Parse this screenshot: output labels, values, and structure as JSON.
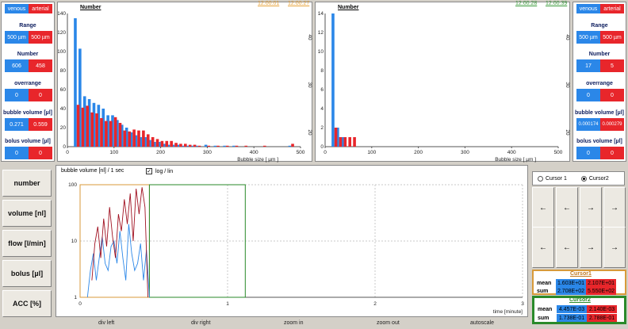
{
  "left_panel": {
    "tabs": {
      "venous": "venous",
      "arterial": "arterial"
    },
    "range": {
      "label": "Range",
      "venous": "500 µm",
      "arterial": "500 µm"
    },
    "number": {
      "label": "Number",
      "venous": "606",
      "arterial": "458"
    },
    "overrange": {
      "label": "overrange",
      "venous": "0",
      "arterial": "0"
    },
    "bubble_volume": {
      "label": "bubble volume [µl]",
      "venous": "0.271",
      "arterial": "0.559"
    },
    "bolus_volume": {
      "label": "bolus volume [µl]",
      "venous": "0",
      "arterial": "0"
    }
  },
  "right_panel": {
    "tabs": {
      "venous": "venous",
      "arterial": "arterial"
    },
    "range": {
      "label": "Range",
      "venous": "500 µm",
      "arterial": "500 µm"
    },
    "number": {
      "label": "Number",
      "venous": "17",
      "arterial": "5"
    },
    "overrange": {
      "label": "overrange",
      "venous": "0",
      "arterial": "0"
    },
    "bubble_volume": {
      "label": "bubble volume [µl]",
      "venous": "0.000174",
      "arterial": "0.000279"
    },
    "bolus_volume": {
      "label": "bolus volume [µl]",
      "venous": "0",
      "arterial": "0"
    }
  },
  "hist1": {
    "title": "Number",
    "time_a": "12:00:01",
    "time_b": "12:00:27",
    "color_a": "#e8a33a",
    "color_b": "#e8a33a",
    "xlabel": "Bubble size [ µm ]",
    "y_right_ticks": [
      "40",
      "30",
      "20"
    ]
  },
  "hist2": {
    "title": "Number",
    "time_a": "12:00:28",
    "time_b": "12:00:39",
    "color_a": "#3a9a3a",
    "color_b": "#3a9a3a",
    "xlabel": "Bubble size [ µm ]",
    "y_right_ticks": [
      "40",
      "30",
      "20"
    ]
  },
  "left_buttons": [
    "number",
    "volume [nl]",
    "flow [l/min]",
    "bolus [µl]",
    "ACC [%]"
  ],
  "trend": {
    "ylabel": "bubble volume [nl] / 1 sec",
    "log_label": "log / lin",
    "log_checked": true,
    "xlabel": "time [minute]",
    "yticks": [
      "100",
      "10",
      "1"
    ],
    "xticks": [
      "0",
      "1",
      "2",
      "3"
    ]
  },
  "bottom_actions": [
    "div left",
    "div right",
    "zoom in",
    "zoom out",
    "autoscale"
  ],
  "cursor_select": {
    "cursor1": "Cursor 1",
    "cursor2": "Cursor2",
    "selected": "Cursor2"
  },
  "arrows": {
    "big_left": "←",
    "small_left": "←",
    "small_right": "→",
    "big_right": "→"
  },
  "cursor1": {
    "title": "Cursor1",
    "mean_label": "mean",
    "sum_label": "sum",
    "mean_v": "1.603E+01",
    "mean_a": "2.107E+01",
    "sum_v": "2.708E+02",
    "sum_a": "5.550E+02",
    "color": "#d89a3a"
  },
  "cursor2": {
    "title": "Cursor2",
    "mean_label": "mean",
    "sum_label": "sum",
    "mean_v": "4.457E-03",
    "mean_a": "2.140E-03",
    "sum_v": "1.738E-01",
    "sum_a": "2.788E-01",
    "color": "#2a8a2a"
  },
  "chart_data": [
    {
      "type": "bar",
      "title": "Number",
      "xlabel": "Bubble size [ µm ]",
      "xlim": [
        0,
        500
      ],
      "ylim": [
        0,
        140
      ],
      "xticks": [
        0,
        100,
        200,
        300,
        400,
        500
      ],
      "yticks": [
        0,
        20,
        40,
        60,
        80,
        100,
        120,
        140
      ],
      "x": [
        20,
        30,
        40,
        50,
        60,
        70,
        80,
        90,
        100,
        110,
        120,
        130,
        140,
        150,
        160,
        170,
        180,
        190,
        200,
        210,
        220,
        230,
        240,
        250,
        260,
        270,
        280,
        300,
        320,
        340,
        360,
        380,
        420,
        480
      ],
      "series": [
        {
          "name": "venous",
          "color": "#2b87e8",
          "values": [
            135,
            103,
            53,
            50,
            46,
            44,
            40,
            33,
            33,
            28,
            23,
            20,
            15,
            12,
            10,
            10,
            7,
            5,
            5,
            3,
            2,
            2,
            2,
            1,
            1,
            1,
            1,
            2,
            1,
            1,
            1,
            0,
            0,
            1
          ]
        },
        {
          "name": "arterial",
          "color": "#e8262b",
          "values": [
            44,
            41,
            43,
            36,
            35,
            30,
            27,
            27,
            31,
            25,
            17,
            16,
            18,
            17,
            17,
            13,
            10,
            8,
            6,
            6,
            6,
            4,
            3,
            3,
            2,
            2,
            1,
            1,
            1,
            1,
            1,
            1,
            1,
            3
          ]
        }
      ]
    },
    {
      "type": "bar",
      "title": "Number",
      "xlabel": "Bubble size [ µm ]",
      "xlim": [
        0,
        500
      ],
      "ylim": [
        0,
        14
      ],
      "xticks": [
        0,
        100,
        200,
        300,
        400,
        500
      ],
      "yticks": [
        0,
        2,
        4,
        6,
        8,
        10,
        12,
        14
      ],
      "x": [
        20,
        30,
        40,
        50,
        60
      ],
      "series": [
        {
          "name": "venous",
          "color": "#2b87e8",
          "values": [
            14,
            2,
            1,
            0,
            0
          ]
        },
        {
          "name": "arterial",
          "color": "#e8262b",
          "values": [
            2,
            1,
            1,
            1,
            1
          ]
        }
      ]
    },
    {
      "type": "line",
      "ylabel": "bubble volume [nl] / 1 sec",
      "xlabel": "time [minute]",
      "xlim": [
        0,
        3
      ],
      "ylim": [
        1,
        100
      ],
      "log_y": true,
      "series": [
        {
          "name": "venous",
          "color": "#2b87e8",
          "x": [
            0.05,
            0.07,
            0.09,
            0.11,
            0.13,
            0.15,
            0.17,
            0.19,
            0.21,
            0.23,
            0.25,
            0.27,
            0.29,
            0.31,
            0.33,
            0.35,
            0.37,
            0.39,
            0.41,
            0.43,
            0.45,
            0.47
          ],
          "values": [
            1,
            3,
            6,
            2,
            5,
            12,
            4,
            3,
            8,
            10,
            4,
            15,
            5,
            2,
            20,
            6,
            3,
            4,
            9,
            2,
            7,
            1
          ]
        },
        {
          "name": "arterial",
          "color": "#a01020",
          "x": [
            0.08,
            0.1,
            0.12,
            0.14,
            0.16,
            0.18,
            0.2,
            0.22,
            0.24,
            0.26,
            0.28,
            0.3,
            0.32,
            0.34,
            0.36,
            0.38,
            0.4,
            0.42,
            0.44,
            0.46
          ],
          "values": [
            2,
            9,
            18,
            5,
            25,
            8,
            40,
            12,
            5,
            30,
            15,
            55,
            20,
            70,
            10,
            85,
            30,
            90,
            40,
            1
          ]
        }
      ]
    }
  ]
}
